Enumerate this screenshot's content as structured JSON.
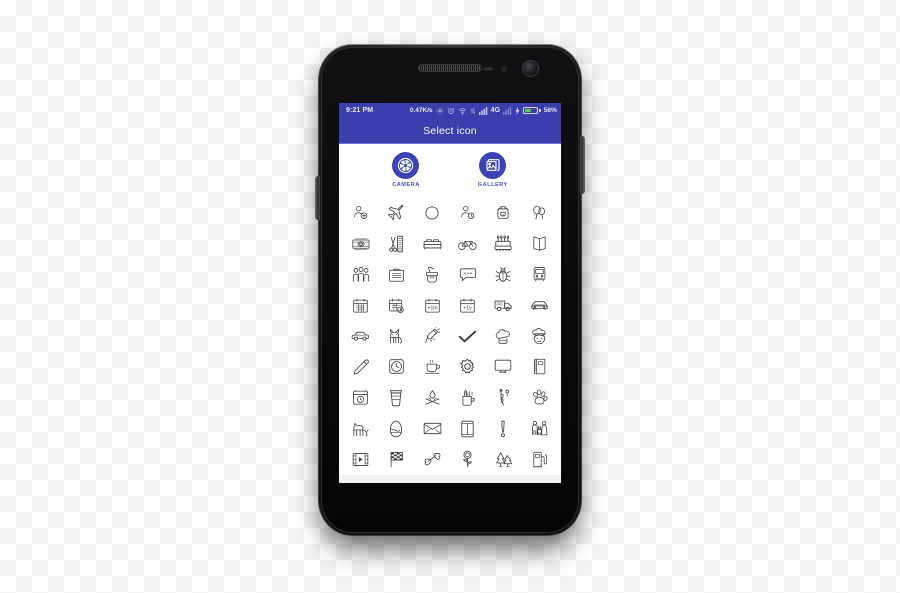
{
  "device": {
    "type": "android-smartphone",
    "frame_color": "#121214",
    "buttons": [
      {
        "name": "right-side-button",
        "side": "right"
      },
      {
        "name": "left-side-button",
        "side": "left"
      }
    ],
    "front_camera": "front-camera",
    "earpiece": "earpiece-speaker"
  },
  "statusbar": {
    "background": "#3b3fae",
    "clock": "9:21 PM",
    "network_speed": "0.47K/s",
    "icons": [
      "settings-gear-icon",
      "alarm-clock-icon",
      "wifi-icon",
      "data-transfer-icon",
      "signal-bars-icon"
    ],
    "network_type": "4G",
    "second_signal_icon": "signal-bars-faded-icon",
    "charging_icon": "charging-bolt-icon",
    "battery_percent": "56%",
    "battery_level": 56,
    "battery_color": "#57d35a"
  },
  "titlebar": {
    "title": "Select icon",
    "background": "#3b3fae",
    "text_color": "#ffffff"
  },
  "sources": [
    {
      "id": "camera",
      "label": "CAMERA",
      "icon": "camera-aperture-icon",
      "color": "#3a44b8"
    },
    {
      "id": "gallery",
      "label": "GALLERY",
      "icon": "gallery-photo-icon",
      "color": "#3a44b8"
    }
  ],
  "grid": {
    "columns": 6,
    "rows": 9,
    "count": 54,
    "stroke_color": "#3a3a3a",
    "background": "#ffffff",
    "icons": [
      "add-person-icon",
      "airplane-icon",
      "circle-icon",
      "person-schedule-icon",
      "backpack-icon",
      "balloons-icon",
      "banknote-money-icon",
      "barber-scissors-icon",
      "bed-icon",
      "bicycle-icon",
      "birthday-cake-icon",
      "open-book-icon",
      "group-people-icon",
      "briefcase-icon",
      "paint-brush-icon",
      "chat-bubble-icon",
      "bug-icon",
      "bus-icon",
      "calendar-icon",
      "calendar-clock-icon",
      "calendar-plus-1m-icon",
      "calendar-plus-1y-icon",
      "delivery-truck-icon",
      "car-front-icon",
      "car-side-icon",
      "cat-icon",
      "champagne-bottle-icon",
      "checkmark-icon",
      "chef-hat-icon",
      "chef-face-icon",
      "clip-pen-icon",
      "clock-icon",
      "coffee-cup-saucer-icon",
      "gear-settings-icon",
      "monitor-icon",
      "notebook-icon",
      "camera-timer-icon",
      "coffee-togo-icon",
      "campfire-icon",
      "pencil-cup-icon",
      "caduceus-medical-icon",
      "paw-print-icon",
      "dog-icon",
      "easter-egg-icon",
      "envelope-mail-icon",
      "door-icon",
      "exclamation-mark-icon",
      "family-icon",
      "film-video-icon",
      "checkered-flag-icon",
      "bone-icon",
      "flower-rose-icon",
      "forest-trees-icon",
      "fuel-pump-icon"
    ],
    "labels": [
      "+1m",
      "+1y"
    ]
  }
}
